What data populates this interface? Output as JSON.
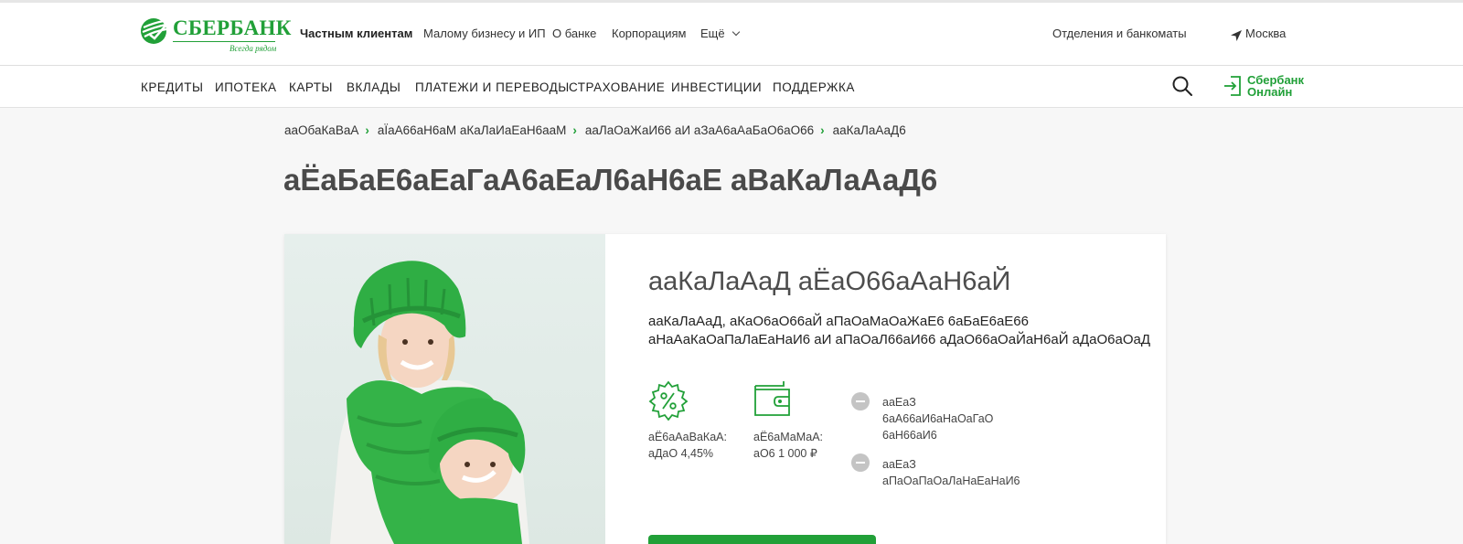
{
  "header": {
    "logo_text": "СБЕРБАНК",
    "logo_tagline": "Всегда рядом",
    "nav": [
      "Частным клиентам",
      "Малому бизнесу и ИП",
      "О банке",
      "Корпорациям",
      "Ещё"
    ],
    "branches": "Отделения и банкоматы",
    "city": "Москва"
  },
  "categories": [
    "КРЕДИТЫ",
    "ИПОТЕКА",
    "КАРТЫ",
    "ВКЛАДЫ",
    "ПЛАТЕЖИ И ПЕРЕВОДЫ",
    "СТРАХОВАНИЕ",
    "ИНВЕСТИЦИИ",
    "ПОДДЕРЖКА"
  ],
  "online": {
    "line1": "Сбербанк",
    "line2": "Онлайн"
  },
  "breadcrumb": [
    "ааОбаКаВаА",
    "аЇаА66аН6аМ аКаЛаИаЕаН6ааМ",
    "ааЛаОаЖаИ66 аИ аЗаА6аАаБаО6аО66",
    "ааКаЛаАаД6"
  ],
  "page_title": "аЁаБаЕ6аЕаГаА6аЕаЛ6аН6аЕ аВаКаЛаАаД6",
  "card": {
    "title": "ааКаЛаАаД аЁаО66аАаН6аЙ",
    "desc_line1": "ааКаЛаАаД, аКаО6аО66аЙ аПаОаМаОаЖаЕ6 6аБаЕ6аЕ66",
    "desc_line2": "аНаАаКаОаПаЛаЕаНаИ6 аИ аПаОаЛ66аИ66 аДаО66аОаЙаН6аЙ аДаО6аОаД",
    "feature_rate": {
      "label": "аЁ6аАаВаКаА:",
      "value": "аДаО 4,45%"
    },
    "feature_amount": {
      "label": "аЁ6аМаМаА:",
      "value": "аО6 1 000 ₽"
    },
    "side_items": [
      {
        "line1": "ааЕаЗ",
        "line2": "6аА66аИ6аНаОаГаО",
        "line3": "6аН66аИ6"
      },
      {
        "line1": "ааЕаЗ",
        "line2": "аПаОаПаОаЛаНаЕаНаИ6"
      }
    ]
  },
  "colors": {
    "brand_green": "#21a038",
    "page_bg": "#f7f7f7"
  }
}
